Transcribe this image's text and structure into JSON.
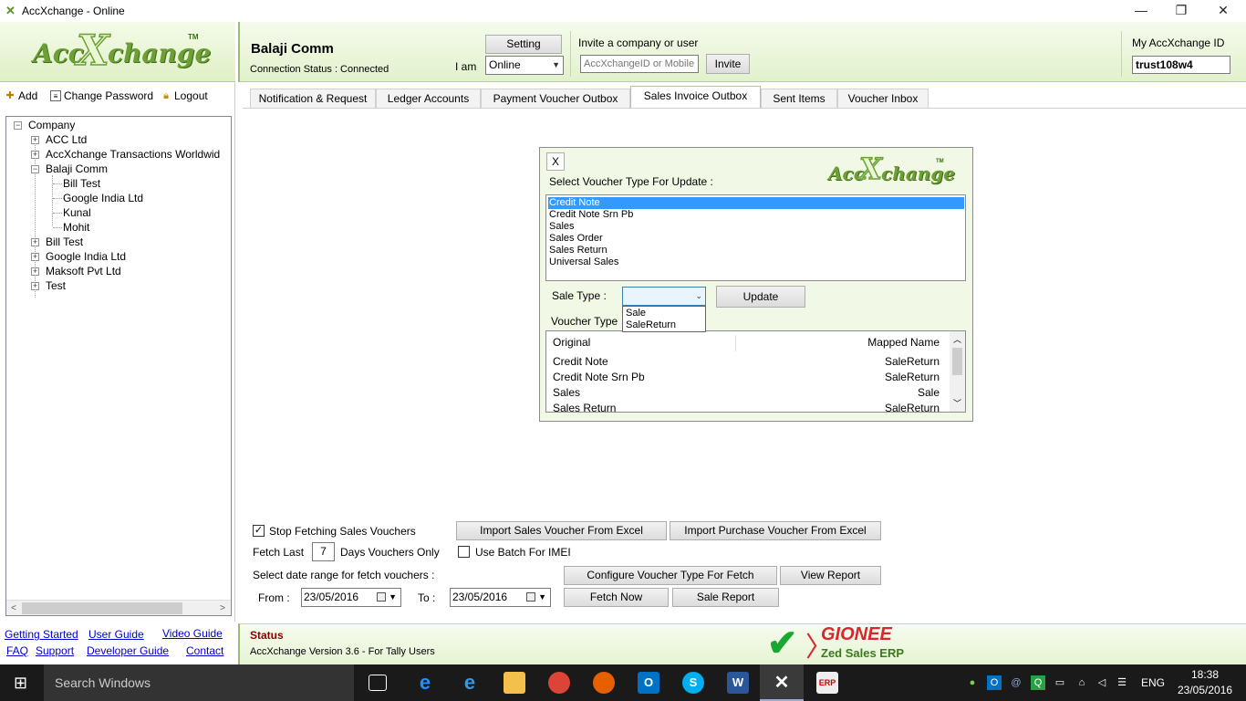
{
  "window": {
    "title": "AccXchange - Online",
    "minimize": "—",
    "maximize": "❐",
    "close": "✕"
  },
  "logo": {
    "part1": "Acc",
    "part2": "X",
    "part3": "change",
    "tm": "TM"
  },
  "left_toolbar": {
    "add": "Add",
    "change_password": "Change Password",
    "logout": "Logout"
  },
  "tree": {
    "root": "Company",
    "items": [
      {
        "label": "ACC Ltd"
      },
      {
        "label": "AccXchange Transactions Worldwid"
      },
      {
        "label": "Balaji Comm"
      },
      {
        "label": "Bill Test"
      },
      {
        "label": "Google India Ltd"
      },
      {
        "label": "Kunal"
      },
      {
        "label": "Mohit"
      },
      {
        "label": "Bill Test"
      },
      {
        "label": "Google India Ltd"
      },
      {
        "label": "Maksoft Pvt Ltd"
      },
      {
        "label": "Test"
      }
    ]
  },
  "links": {
    "getting_started": "Getting Started",
    "user_guide": "User Guide",
    "video_guide": "Video Guide",
    "faq": "FAQ",
    "support": "Support",
    "developer_guide": "Developer Guide",
    "contact": "Contact"
  },
  "header": {
    "company": "Balaji Comm",
    "connection_status": "Connection Status : Connected",
    "setting": "Setting",
    "i_am": "I am",
    "status_value": "Online",
    "invite_label": "Invite a company or user",
    "invite_placeholder": "AccXchangeID or Mobile",
    "invite_button": "Invite",
    "my_id_label": "My AccXchange ID",
    "my_id_value": "trust108w4"
  },
  "tabs": [
    {
      "label": "Notification & Request"
    },
    {
      "label": "Ledger Accounts"
    },
    {
      "label": "Payment Voucher Outbox"
    },
    {
      "label": "Sales Invoice Outbox"
    },
    {
      "label": "Sent Items"
    },
    {
      "label": "Voucher Inbox"
    }
  ],
  "dialog": {
    "close": "X",
    "heading": "Select Voucher Type For Update :",
    "voucher_types": [
      "Credit Note",
      "Credit Note Srn Pb",
      "Sales",
      "Sales Order",
      "Sales Return",
      "Universal Sales"
    ],
    "selected_index": 0,
    "sale_type_label": "Sale Type :",
    "sale_type_value": "",
    "sale_type_options": [
      "Sale",
      "SaleReturn"
    ],
    "update_button": "Update",
    "voucher_type_label": "Voucher Type",
    "grid_headers": {
      "original": "Original",
      "mapped": "Mapped Name"
    },
    "grid_rows": [
      {
        "original": "Credit Note",
        "mapped": "SaleReturn"
      },
      {
        "original": "Credit Note Srn Pb",
        "mapped": "SaleReturn"
      },
      {
        "original": "Sales",
        "mapped": "Sale"
      },
      {
        "original": "Sales Return",
        "mapped": "SaleReturn"
      }
    ]
  },
  "bottom": {
    "stop_fetching": "Stop Fetching Sales Vouchers",
    "stop_fetching_checked": true,
    "import_sales": "Import Sales Voucher From Excel",
    "import_purchase": "Import Purchase Voucher From Excel",
    "fetch_last": "Fetch Last",
    "fetch_days": "7",
    "days_vouchers_only": "Days Vouchers Only",
    "use_batch": "Use Batch For IMEI",
    "use_batch_checked": false,
    "date_range_label": "Select date range for fetch vouchers :",
    "from_label": "From :",
    "from_date": "23/05/2016",
    "to_label": "To :",
    "to_date": "23/05/2016",
    "configure": "Configure Voucher Type For Fetch",
    "view_report": "View Report",
    "fetch_now": "Fetch Now",
    "sale_report": "Sale Report"
  },
  "status": {
    "title": "Status",
    "version": "AccXchange Version 3.6 - For Tally Users",
    "brand": "GIONEE",
    "brand_sub": "Zed Sales ERP"
  },
  "taskbar": {
    "search": "Search Windows",
    "lang": "ENG",
    "time": "18:38",
    "date": "23/05/2016"
  },
  "colors": {
    "accent_green": "#6ca034",
    "brand_red": "#d9272e",
    "selection": "#3399ff"
  }
}
